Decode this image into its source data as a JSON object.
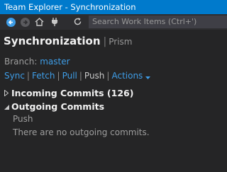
{
  "window": {
    "title": "Team Explorer - Synchronization"
  },
  "toolbar": {
    "buttons": [
      {
        "icon": "back-arrow-icon"
      },
      {
        "icon": "forward-arrow-icon"
      },
      {
        "icon": "home-icon"
      },
      {
        "icon": "plug-icon"
      },
      {
        "icon": "refresh-icon"
      }
    ],
    "search_placeholder": "Search Work Items (Ctrl+')"
  },
  "header": {
    "title": "Synchronization",
    "separator": "|",
    "project": "Prism"
  },
  "branch": {
    "label": "Branch:",
    "value": "master"
  },
  "actions": {
    "sync": "Sync",
    "fetch": "Fetch",
    "pull": "Pull",
    "push": "Push",
    "more": "Actions",
    "separator": "|"
  },
  "incoming": {
    "label": "Incoming Commits (126)"
  },
  "outgoing": {
    "label": "Outgoing Commits",
    "push_label": "Push",
    "empty_message": "There are no outgoing commits."
  },
  "colors": {
    "accent": "#007acc",
    "link": "#3e9de7",
    "background": "#252526"
  }
}
